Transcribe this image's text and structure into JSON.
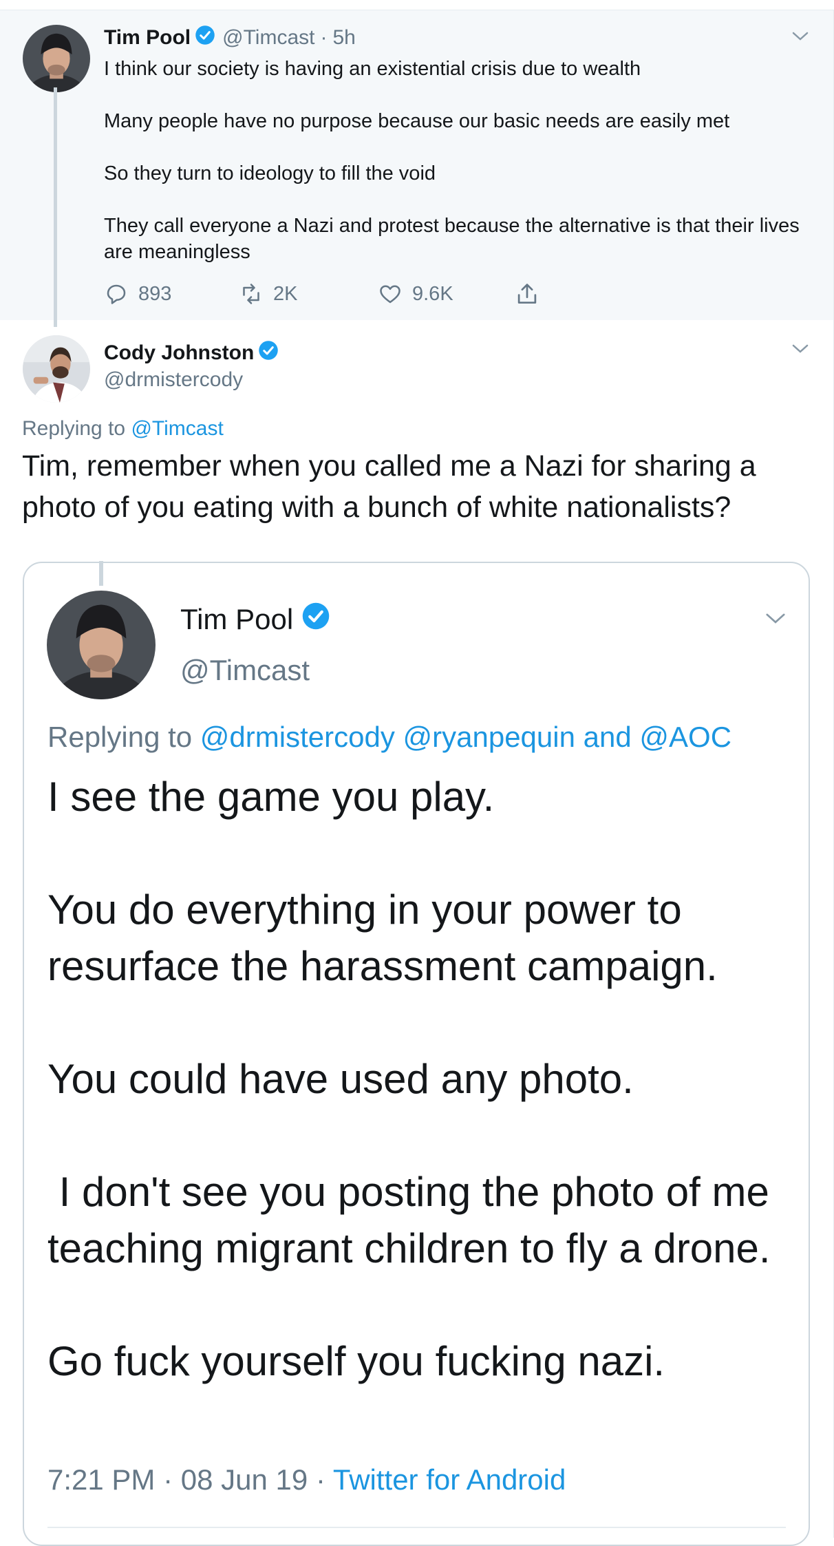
{
  "parent_tweet": {
    "name": "Tim Pool",
    "handle": "@Timcast",
    "sep": "·",
    "time": "5h",
    "text": "I think our society is having an existential crisis due to wealth\n\nMany people have no purpose because our basic needs are easily met\n\nSo they turn to ideology to fill the void\n\nThey call everyone a Nazi and protest because the alternative is that their lives are meaningless",
    "replies": "893",
    "retweets": "2K",
    "likes": "9.6K"
  },
  "reply_tweet": {
    "name": "Cody Johnston",
    "handle": "@drmistercody",
    "replying_prefix": "Replying to",
    "replying_to": "@Timcast",
    "text": "Tim, remember when you called me a Nazi for sharing a photo of you eating with a bunch of white nationalists?"
  },
  "quoted_tweet": {
    "name": "Tim Pool",
    "handle": "@Timcast",
    "replying_prefix": "Replying to",
    "replying_to": "@drmistercody @ryanpequin and @AOC",
    "text": "I see the game you play.\n\nYou do everything in your power to resurface the harassment campaign.\n\nYou could have used any photo.\n\n I don't see you posting the photo of me teaching migrant children to fly a drone.\n\nGo fuck yourself you fucking nazi.",
    "time": "7:21 PM",
    "sep1": "·",
    "date": "08 Jun 19",
    "sep2": "·",
    "source": "Twitter for Android"
  },
  "icons": {
    "verified": "verified-badge-icon",
    "chevron": "chevron-down-icon",
    "reply": "reply-icon",
    "retweet": "retweet-icon",
    "like": "heart-icon",
    "share": "share-icon"
  },
  "colors": {
    "link": "#1b95e0",
    "verified": "#1da1f2",
    "muted": "#657786",
    "parent_bg": "#f5f8fa"
  }
}
